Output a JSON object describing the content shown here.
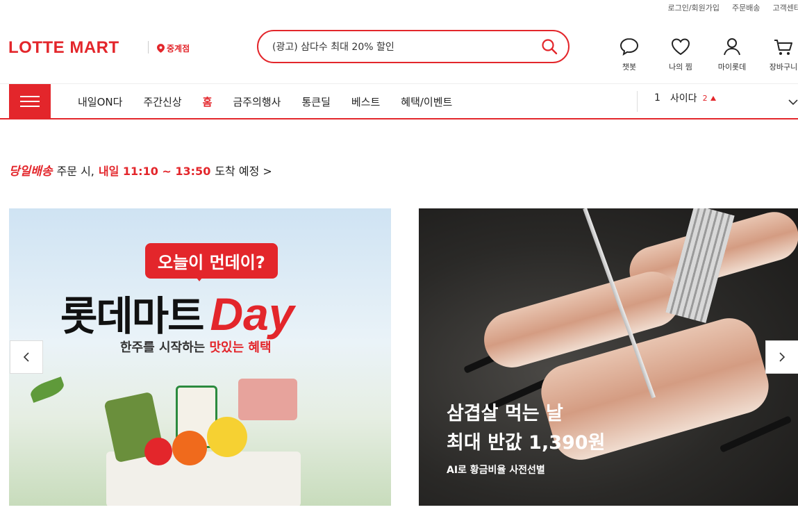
{
  "top_links": [
    "로그인/회원가입",
    "주문배송",
    "고객센터"
  ],
  "logo": "LOTTE MART",
  "store": "중계점",
  "search": {
    "value": "(광고) 삼다수 최대 20% 할인"
  },
  "utilities": [
    {
      "label": "챗봇",
      "icon": "chat-icon"
    },
    {
      "label": "나의 찜",
      "icon": "heart-icon"
    },
    {
      "label": "마이롯데",
      "icon": "user-icon"
    },
    {
      "label": "장바구니",
      "icon": "cart-icon"
    }
  ],
  "nav": {
    "items": [
      "내일ON다",
      "주간신상",
      "홈",
      "금주의행사",
      "통큰딜",
      "베스트",
      "혜택/이벤트"
    ],
    "active": "홈"
  },
  "ranking": {
    "rank": "1",
    "keyword": "사이다",
    "change": "2"
  },
  "delivery": {
    "badge": "당일배송",
    "text1": "주문 시,",
    "time": "내일 11:10 ~ 13:50",
    "text2": "도착 예정 >"
  },
  "banner_left": {
    "bubble": "오늘이 먼데이?",
    "headline_ko": "롯데마트",
    "headline_en": "Day",
    "sub_prefix": "한주를 시작하는",
    "sub_highlight": "맛있는 혜택"
  },
  "banner_right": {
    "title_line1": "삼겹살 먹는 날",
    "title_line2": "최대 반값 1,390원",
    "desc": "AI로 황금비율 사전선별"
  },
  "colors": {
    "brand_red": "#e3262b"
  }
}
